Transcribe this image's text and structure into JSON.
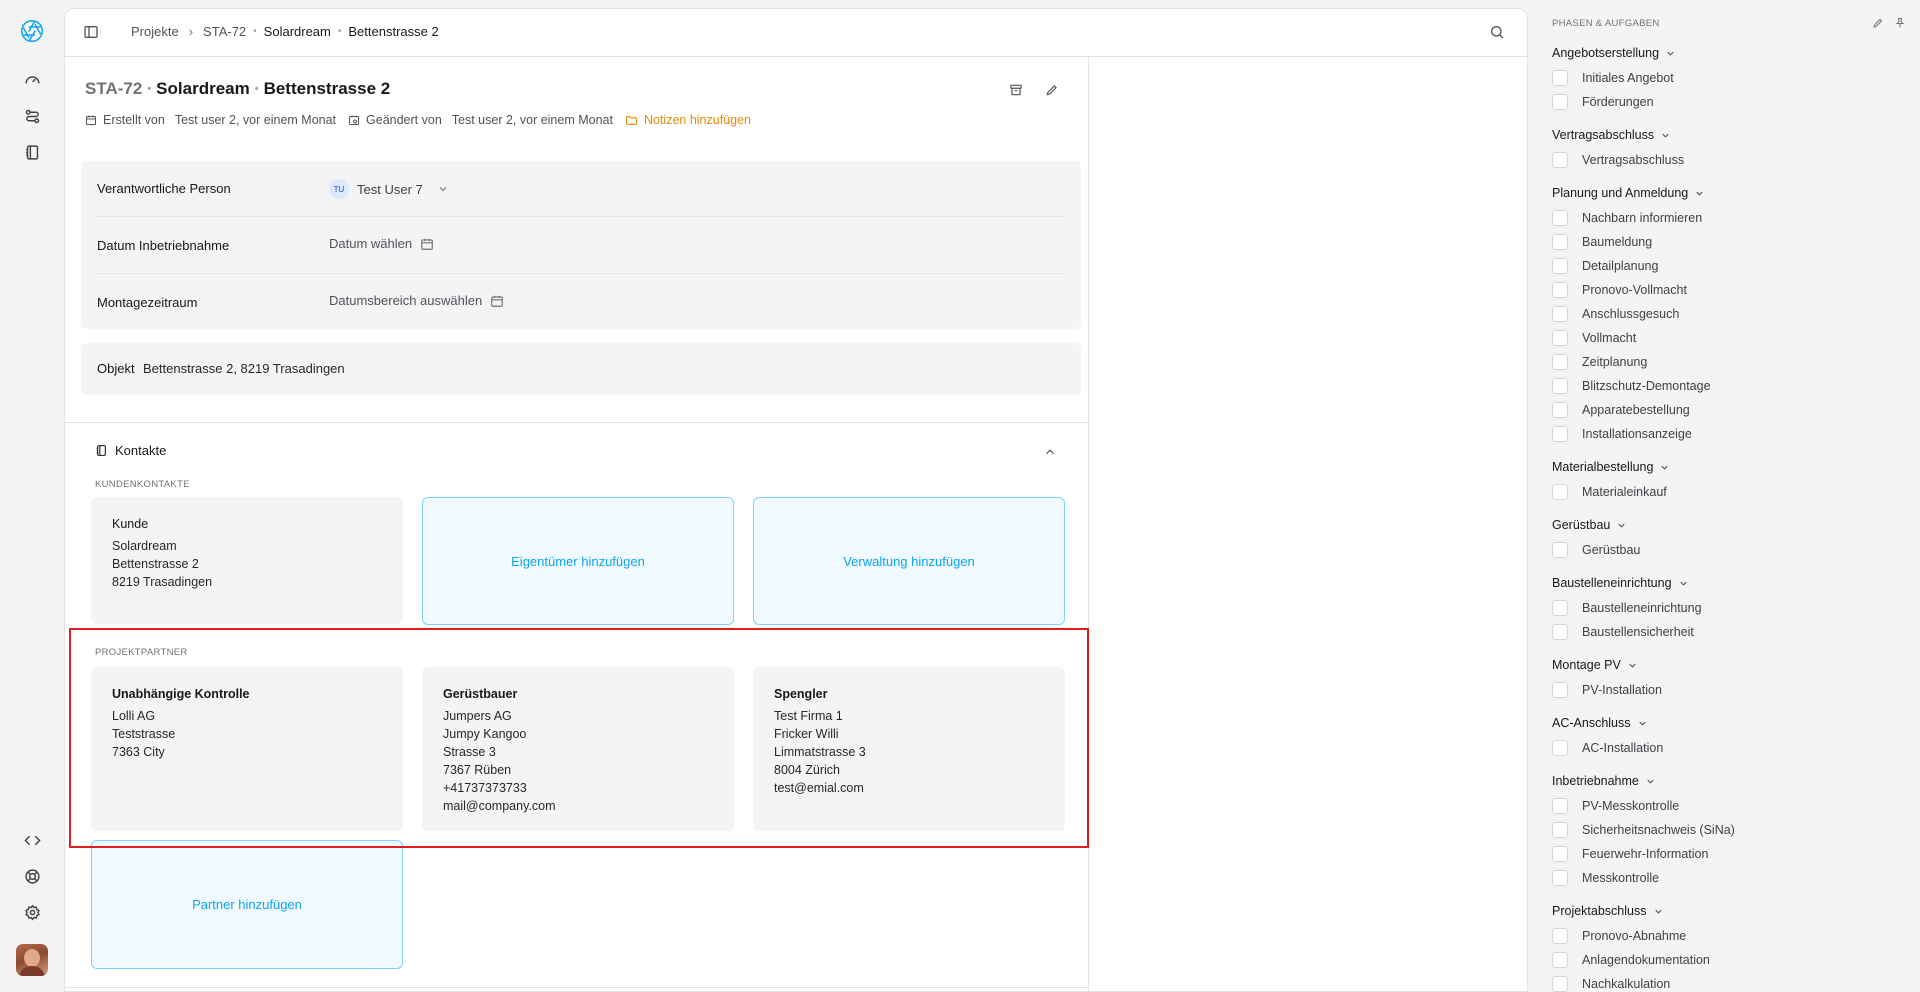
{
  "breadcrumb": {
    "root": "Projekte",
    "id": "STA-72",
    "client": "Solardream",
    "address": "Bettenstrasse 2"
  },
  "project": {
    "id": "STA-72",
    "client": "Solardream",
    "address": "Bettenstrasse 2",
    "created_label": "Erstellt von",
    "created_value": "Test user 2, vor einem Monat",
    "changed_label": "Geändert von",
    "changed_value": "Test user 2, vor einem Monat",
    "notes_label": "Notizen hinzufügen"
  },
  "fields": {
    "person_label": "Verantwortliche Person",
    "person_initials": "TU",
    "person_value": "Test User 7",
    "date_label": "Datum Inbetriebnahme",
    "date_placeholder": "Datum wählen",
    "range_label": "Montagezeitraum",
    "range_placeholder": "Datumsbereich auswählen"
  },
  "objekt": {
    "label": "Objekt",
    "value": "Bettenstrasse 2, 8219 Trasadingen"
  },
  "kontakte": {
    "title": "Kontakte",
    "kunden_label": "KUNDENKONTAKTE",
    "kunde": {
      "title": "Kunde",
      "lines": [
        "Solardream",
        "Bettenstrasse 2",
        "8219 Trasadingen"
      ]
    },
    "add_eigentuemer": "Eigentümer hinzufügen",
    "add_verwaltung": "Verwaltung hinzufügen",
    "partner_label": "PROJEKTPARTNER",
    "partners": [
      {
        "title": "Unabhängige Kontrolle",
        "lines": [
          "Lolli AG",
          "Teststrasse",
          "7363 City"
        ]
      },
      {
        "title": "Gerüstbauer",
        "lines": [
          "Jumpers AG",
          "Jumpy Kangoo",
          "Strasse 3",
          "7367 Rüben",
          "+41737373733",
          "mail@company.com"
        ]
      },
      {
        "title": "Spengler",
        "lines": [
          "Test Firma 1",
          "Fricker Willi",
          "Limmatstrasse 3",
          "8004 Zürich",
          "test@emial.com"
        ]
      }
    ],
    "add_partner": "Partner hinzufügen"
  },
  "sidebar": {
    "title": "PHASEN & AUFGABEN",
    "groups": [
      {
        "name": "Angebotserstellung",
        "tasks": [
          "Initiales Angebot",
          "Förderungen"
        ]
      },
      {
        "name": "Vertragsabschluss",
        "tasks": [
          "Vertragsabschluss"
        ]
      },
      {
        "name": "Planung und Anmeldung",
        "tasks": [
          "Nachbarn informieren",
          "Baumeldung",
          "Detailplanung",
          "Pronovo-Vollmacht",
          "Anschlussgesuch",
          "Vollmacht",
          "Zeitplanung",
          "Blitzschutz-Demontage",
          "Apparatebestellung",
          "Installationsanzeige"
        ]
      },
      {
        "name": "Materialbestellung",
        "tasks": [
          "Materialeinkauf"
        ]
      },
      {
        "name": "Gerüstbau",
        "tasks": [
          "Gerüstbau"
        ]
      },
      {
        "name": "Baustelleneinrichtung",
        "tasks": [
          "Baustelleneinrichtung",
          "Baustellensicherheit"
        ]
      },
      {
        "name": "Montage PV",
        "tasks": [
          "PV-Installation"
        ]
      },
      {
        "name": "AC-Anschluss",
        "tasks": [
          "AC-Installation"
        ]
      },
      {
        "name": "Inbetriebnahme",
        "tasks": [
          "PV-Messkontrolle",
          "Sicherheitsnachweis (SiNa)",
          "Feuerwehr-Information",
          "Messkontrolle"
        ]
      },
      {
        "name": "Projektabschluss",
        "tasks": [
          "Pronovo-Abnahme",
          "Anlagendokumentation",
          "Nachkalkulation"
        ]
      }
    ]
  },
  "icons": {
    "logo": "aperture-logo-icon",
    "dashboard": "gauge-icon",
    "workflows": "route-icon",
    "contacts": "address-book-icon",
    "code": "code-icon",
    "help": "lifebuoy-icon",
    "settings": "gear-icon"
  },
  "colors": {
    "accent": "#0ea5e9",
    "notes": "#ea8a0a",
    "highlight": "#e11d1d"
  }
}
